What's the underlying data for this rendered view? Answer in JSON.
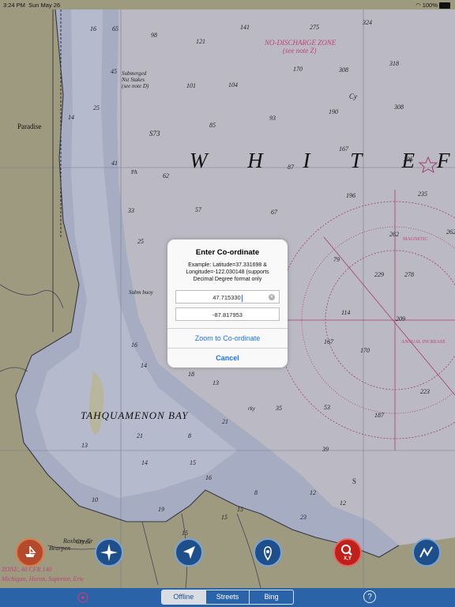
{
  "status_bar": {
    "time": "3:24 PM",
    "date": "Sun May 26",
    "battery": "100%"
  },
  "chart_labels": {
    "no_discharge_zone": "NO-DISCHARGE ZONE",
    "see_note_z": "(see note Z)",
    "white": "W H I T E",
    "white_f": "F",
    "bay": "TAHQUAMENON BAY",
    "paradise": "Paradise",
    "submerged": "Submerged",
    "submerged2": "Nst Stakes",
    "submerged3": "(see note D)",
    "subm_buoy": "Subm buoy",
    "magnetic": "MAGNETIC",
    "annual_increase": "ANNUAL INCREASE",
    "zone_text": "ZONE, 40 CFR 140",
    "michigan_text": "Michigan, Huron, Superior, Erie",
    "roxbury": "Roxbury Cr",
    "bearpen": "Bearpen",
    "creek": "Creek",
    "rky": "rky",
    "s73": "S73",
    "pa": "PA",
    "cy": "Cy",
    "s_mark": "S",
    "soundings": [
      "16",
      "65",
      "98",
      "141",
      "275",
      "324",
      "121",
      "318",
      "45",
      "170",
      "308",
      "101",
      "104",
      "190",
      "308",
      "93",
      "85",
      "167",
      "25",
      "295",
      "14",
      "41",
      "62",
      "87",
      "196",
      "235",
      "57",
      "67",
      "33",
      "262",
      "262",
      "79",
      "25",
      "278",
      "229",
      "114",
      "209",
      "167",
      "16",
      "14",
      "170",
      "18",
      "13",
      "223",
      "53",
      "187",
      "21",
      "35",
      "21",
      "13",
      "8",
      "39",
      "14",
      "15",
      "10",
      "12",
      "8",
      "12",
      "23",
      "15",
      "19",
      "15",
      "15",
      "16"
    ]
  },
  "dialog": {
    "title": "Enter Co-ordinate",
    "message": "Example: Latitude=37.331698 & Longitude=-122.030148 (supports Decimal Degree format only",
    "latitude_value": "47.715330",
    "longitude_value": "-87.817953",
    "zoom_button": "Zoom to Co-ordinate",
    "cancel_button": "Cancel"
  },
  "toolbar": {
    "buttons": [
      "boat-icon",
      "compass-icon",
      "navigate-arrow-icon",
      "location-pin-icon",
      "search-xy-icon",
      "route-icon"
    ],
    "search_label": "X,Y"
  },
  "bottom_bar": {
    "tabs": [
      "Offline",
      "Streets",
      "Bing"
    ],
    "selected_tab": "Offline",
    "help_label": "?"
  },
  "colors": {
    "land": "#b9b48f",
    "water_shallow": "#c9d2e7",
    "water_deep": "#e7e6ea",
    "bar": "#2a63a8",
    "accent": "#1a73e8",
    "magenta": "#c0407a"
  }
}
